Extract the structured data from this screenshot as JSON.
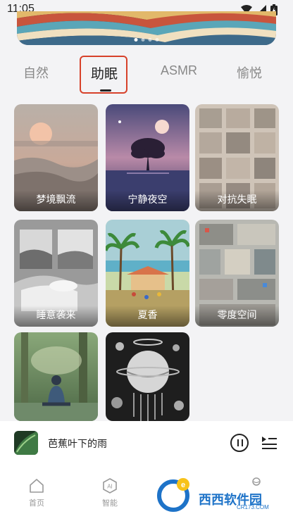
{
  "status_bar": {
    "time": "11:05"
  },
  "tabs": [
    {
      "label": "自然",
      "active": false
    },
    {
      "label": "助眠",
      "active": true
    },
    {
      "label": "ASMR",
      "active": false
    },
    {
      "label": "愉悦",
      "active": false
    }
  ],
  "cards": [
    {
      "label": "梦境飘流"
    },
    {
      "label": "宁静夜空"
    },
    {
      "label": "对抗失眠"
    },
    {
      "label": "睡意袭来"
    },
    {
      "label": "夏香"
    },
    {
      "label": "零度空间"
    },
    {
      "label": ""
    },
    {
      "label": ""
    }
  ],
  "player": {
    "title": "芭蕉叶下的雨"
  },
  "nav": [
    {
      "label": "首页",
      "icon": "home-icon"
    },
    {
      "label": "智能",
      "icon": "ai-icon"
    }
  ],
  "watermark": {
    "text": "西西软件园",
    "sub": "CR173.COM"
  },
  "colors": {
    "highlight": "#d7412a",
    "accent_text": "#222222",
    "muted_text": "#888888"
  }
}
